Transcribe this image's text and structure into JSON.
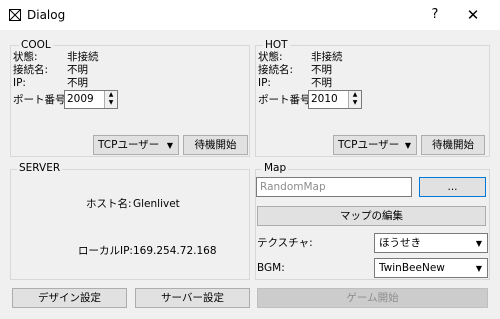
{
  "window": {
    "title": "Dialog",
    "help": "?",
    "close": "✕"
  },
  "cool": {
    "label": "COOL",
    "status_label": "状態:",
    "status_value": "非接続",
    "name_label": "接続名:",
    "name_value": "不明",
    "ip_label": "IP:",
    "ip_value": "不明",
    "port_label": "ポート番号:",
    "port_value": "2009",
    "user_select": "TCPユーザー",
    "wait_button": "待機開始"
  },
  "hot": {
    "label": "HOT",
    "status_label": "状態:",
    "status_value": "非接続",
    "name_label": "接続名:",
    "name_value": "不明",
    "ip_label": "IP:",
    "ip_value": "不明",
    "port_label": "ポート番号:",
    "port_value": "2010",
    "user_select": "TCPユーザー",
    "wait_button": "待機開始"
  },
  "server": {
    "label": "SERVER",
    "host_label": "ホスト名:",
    "host_value": "Glenlivet",
    "local_ip_label": "ローカルIP:",
    "local_ip_value": "169.254.72.168"
  },
  "map": {
    "label": "Map",
    "map_placeholder": "RandomMap",
    "browse_button": "...",
    "edit_button": "マップの編集",
    "texture_label": "テクスチャ:",
    "texture_value": "ほうせき",
    "bgm_label": "BGM:",
    "bgm_value": "TwinBeeNew"
  },
  "footer": {
    "design_button": "デザイン設定",
    "server_button": "サーバー設定",
    "start_button": "ゲーム開始"
  },
  "icons": {
    "spin_up": "▲",
    "spin_down": "▼",
    "dropdown": "▼"
  }
}
